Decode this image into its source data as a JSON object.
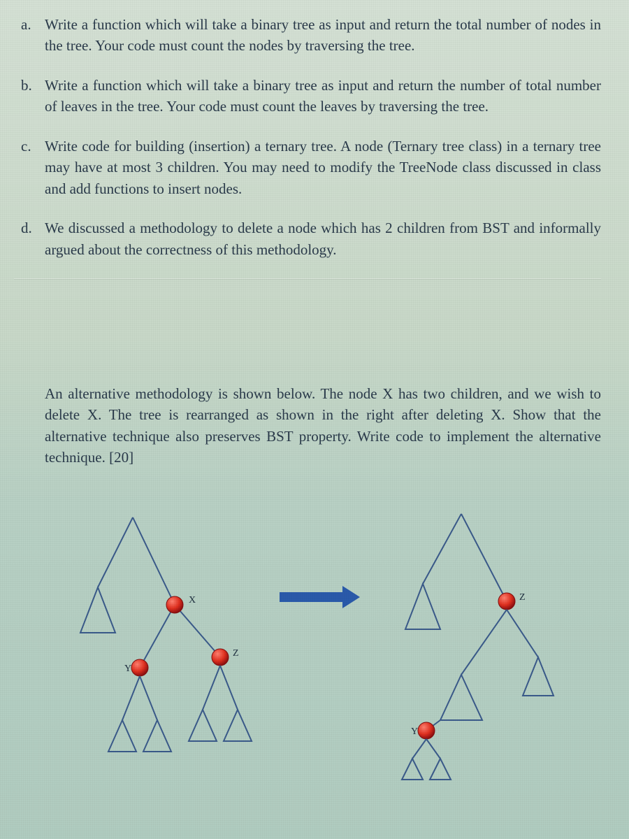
{
  "questions": {
    "a": {
      "marker": "a.",
      "text": "Write a function which will take a binary tree as input and return the total number of nodes in the tree. Your code must count the nodes by traversing the tree."
    },
    "b": {
      "marker": "b.",
      "text": "Write a function which will take a binary tree as input and return the number of total number of leaves in the tree. Your code must count the leaves by traversing the tree."
    },
    "c": {
      "marker": "c.",
      "text": "Write code for building (insertion) a ternary tree. A node (Ternary tree class) in a ternary tree may have at most 3 children.  You may need to modify the TreeNode class discussed in class and add functions to insert nodes."
    },
    "d": {
      "marker": "d.",
      "text": "We discussed a methodology to delete a node which has 2 children from BST and informally argued about the correctness of this methodology."
    },
    "alt": {
      "text": "An alternative methodology is shown below. The node X has two children, and we wish to delete X. The tree is rearranged as shown in the right after deleting X. Show that the alternative technique also preserves BST property. Write code to implement the alternative technique. [20]"
    }
  },
  "diagram": {
    "labels": {
      "x": "X",
      "y": "Y",
      "z": "Z"
    },
    "colors": {
      "edge": "#3a5a8a",
      "triangle_stroke": "#3a5a8a",
      "triangle_fill": "none",
      "node_fill": "#e03020",
      "node_stroke": "#801010",
      "arrow": "#2a5aaa"
    }
  }
}
